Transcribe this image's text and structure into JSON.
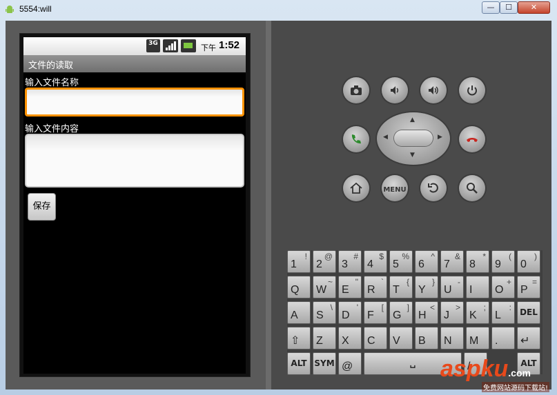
{
  "window": {
    "title": "5554:will",
    "min_glyph": "—",
    "max_glyph": "☐",
    "close_glyph": "✕"
  },
  "status_bar": {
    "network": "3G",
    "ampm": "下午",
    "time": "1:52"
  },
  "app": {
    "title": "文件的读取",
    "filename_label": "输入文件名称",
    "filename_value": "",
    "content_label": "输入文件内容",
    "content_value": "",
    "save_button": "保存"
  },
  "hardware_buttons": {
    "menu": "MENU"
  },
  "keyboard": {
    "rows": [
      [
        {
          "main": "1",
          "alt": "!"
        },
        {
          "main": "2",
          "alt": "@"
        },
        {
          "main": "3",
          "alt": "#"
        },
        {
          "main": "4",
          "alt": "$"
        },
        {
          "main": "5",
          "alt": "%"
        },
        {
          "main": "6",
          "alt": "^"
        },
        {
          "main": "7",
          "alt": "&"
        },
        {
          "main": "8",
          "alt": "*"
        },
        {
          "main": "9",
          "alt": "("
        },
        {
          "main": "0",
          "alt": ")"
        }
      ],
      [
        {
          "main": "Q",
          "alt": ""
        },
        {
          "main": "W",
          "alt": "~"
        },
        {
          "main": "E",
          "alt": "\""
        },
        {
          "main": "R",
          "alt": "`"
        },
        {
          "main": "T",
          "alt": "{"
        },
        {
          "main": "Y",
          "alt": "}"
        },
        {
          "main": "U",
          "alt": "-"
        },
        {
          "main": "I",
          "alt": ""
        },
        {
          "main": "O",
          "alt": "+"
        },
        {
          "main": "P",
          "alt": "="
        }
      ],
      [
        {
          "main": "A",
          "alt": ""
        },
        {
          "main": "S",
          "alt": "\\"
        },
        {
          "main": "D",
          "alt": "'"
        },
        {
          "main": "F",
          "alt": "["
        },
        {
          "main": "G",
          "alt": "]"
        },
        {
          "main": "H",
          "alt": "<"
        },
        {
          "main": "J",
          "alt": ">"
        },
        {
          "main": "K",
          "alt": ";"
        },
        {
          "main": "L",
          "alt": ":"
        },
        {
          "main": "DEL",
          "alt": ""
        }
      ],
      [
        {
          "main": "⇧",
          "alt": ""
        },
        {
          "main": "Z",
          "alt": ""
        },
        {
          "main": "X",
          "alt": ""
        },
        {
          "main": "C",
          "alt": ""
        },
        {
          "main": "V",
          "alt": ""
        },
        {
          "main": "B",
          "alt": ""
        },
        {
          "main": "N",
          "alt": ""
        },
        {
          "main": "M",
          "alt": ""
        },
        {
          "main": ".",
          "alt": ""
        },
        {
          "main": "↵",
          "alt": ""
        }
      ]
    ],
    "bottom_row": {
      "alt_left": "ALT",
      "sym": "SYM",
      "at": "@",
      "space": "␣",
      "tab": "⇥",
      "slash": "/",
      "question": "?",
      "comma": ",",
      "alt_right": "ALT"
    }
  },
  "watermark": {
    "brand": "aspku",
    "suffix": ".com",
    "subtitle": "免费网站源码下载站!"
  },
  "colors": {
    "focus_border": "#ff9200",
    "call_green": "#2c8a2c",
    "end_red": "#c8261f",
    "watermark": "#e8491b"
  }
}
